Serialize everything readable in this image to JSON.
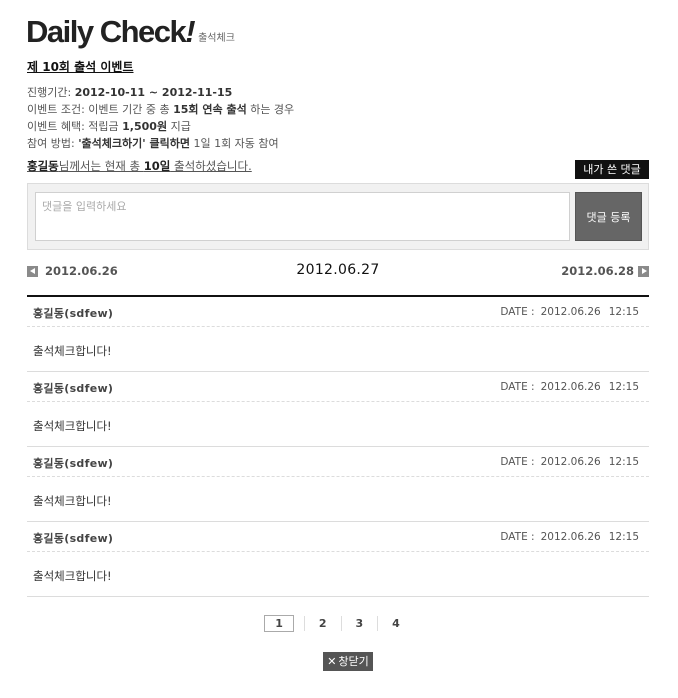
{
  "logo": {
    "main": "Daily Check",
    "bang": "!",
    "sub": "출석체크"
  },
  "event": {
    "title": "제 10회 출석 이벤트",
    "period_label": "진행기간: ",
    "period_value": "2012-10-11 ~ 2012-11-15",
    "condition_label": "이벤트 조건: 이벤트 기간 중 총 ",
    "condition_bold": "15회 연속 출석",
    "condition_tail": " 하는 경우",
    "benefit_label": "이벤트 혜택: 적립금 ",
    "benefit_bold": "1,500원",
    "benefit_tail": " 지급",
    "method_label": "참여 방법: ",
    "method_bold": "'출석체크하기' 클릭하면",
    "method_tail": " 1일 1회 자동 참여"
  },
  "user_status": {
    "name": "홍길동",
    "text1": "님께서는 현재 총 ",
    "days": "10일",
    "text2": " 출석하셨습니다."
  },
  "my_comments_button": "내가 쓴 댓글",
  "comment_input": {
    "placeholder": "댓글을 입력하세요"
  },
  "submit_button": "댓글 등록",
  "date_nav": {
    "prev": "2012.06.26",
    "current": "2012.06.27",
    "next": "2012.06.28"
  },
  "entries": [
    {
      "author": "홍길동(sdfew)",
      "date_label": "DATE :",
      "date": "2012.06.26",
      "time": "12:15",
      "message": "출석체크합니다!"
    },
    {
      "author": "홍길동(sdfew)",
      "date_label": "DATE :",
      "date": "2012.06.26",
      "time": "12:15",
      "message": "출석체크합니다!"
    },
    {
      "author": "홍길동(sdfew)",
      "date_label": "DATE :",
      "date": "2012.06.26",
      "time": "12:15",
      "message": "출석체크합니다!"
    },
    {
      "author": "홍길동(sdfew)",
      "date_label": "DATE :",
      "date": "2012.06.26",
      "time": "12:15",
      "message": "출석체크합니다!"
    }
  ],
  "pagination": {
    "pages": [
      "1",
      "2",
      "3",
      "4"
    ],
    "current": "1"
  },
  "close_button": {
    "icon": "close-icon",
    "label": "창닫기"
  }
}
